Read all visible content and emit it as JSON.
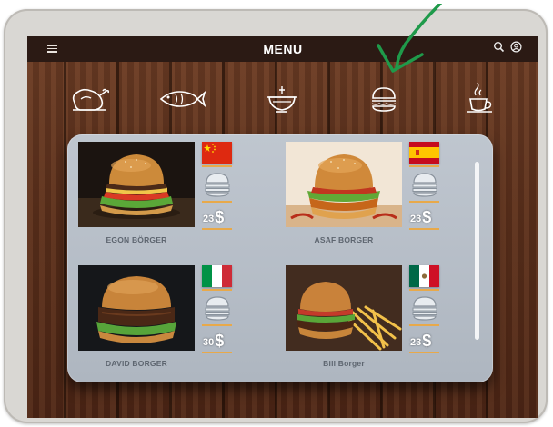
{
  "header": {
    "title": "MENU",
    "menu_icon": "hamburger-icon",
    "search_icon": "search-icon",
    "user_icon": "user-icon"
  },
  "categories": [
    {
      "icon": "chicken-icon"
    },
    {
      "icon": "fish-icon"
    },
    {
      "icon": "bowl-icon"
    },
    {
      "icon": "burger-icon",
      "selected": true
    },
    {
      "icon": "coffee-cup-icon"
    }
  ],
  "items": [
    {
      "name": "EGON BÖRGER",
      "flag": "China",
      "price": "23",
      "currency": "$"
    },
    {
      "name": "ASAF BORGER",
      "flag": "Spain",
      "price": "23",
      "currency": "$"
    },
    {
      "name": "DAVID BORGER",
      "flag": "Italy",
      "price": "30",
      "currency": "$"
    },
    {
      "name": "Bill Borger",
      "flag": "Mexico",
      "price": "23",
      "currency": "$"
    }
  ],
  "colors": {
    "accent": "#e8a94a",
    "annotation_arrow": "#1f9a4a",
    "topbar": "#2b1a14",
    "panel": "#b7bec8"
  }
}
